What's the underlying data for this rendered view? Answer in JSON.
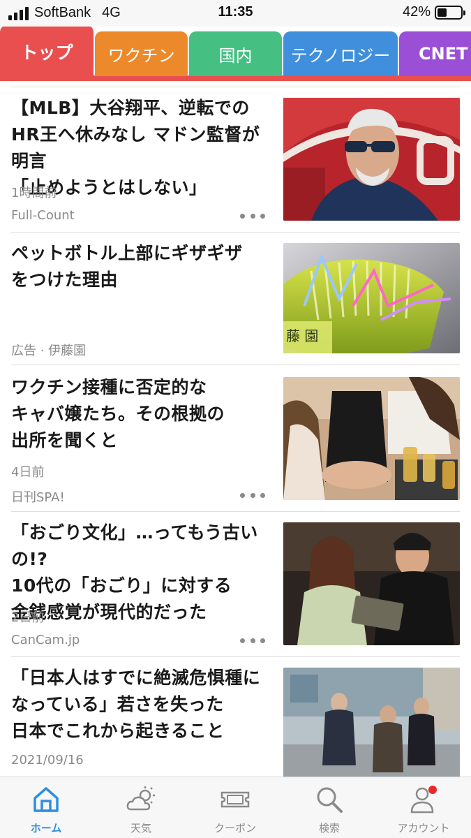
{
  "status_bar": {
    "carrier": "SoftBank",
    "network": "4G",
    "time": "11:35",
    "battery_percent": "42%",
    "battery_level": 0.42
  },
  "tabs": [
    {
      "label": "トップ",
      "color": "#e94f4f",
      "active": true
    },
    {
      "label": "ワクチン",
      "color": "#ec8a2b",
      "active": false
    },
    {
      "label": "国内",
      "color": "#45bf82",
      "active": false
    },
    {
      "label": "テクノロジー",
      "color": "#3f8fdd",
      "active": false
    },
    {
      "label": "CNET",
      "color": "#9b4fd6",
      "active": false
    }
  ],
  "articles": [
    {
      "title": "【MLB】大谷翔平、逆転での\nHR王へ休みなし マドン監督が明言\n「止めようとはしない」",
      "time": "1時間前",
      "source": "Full-Count",
      "image": "older-man-sunglasses-photo",
      "has_more": true
    },
    {
      "title": "ペットボトル上部にギザギザ\nをつけた理由",
      "time": "",
      "source": "広告 · 伊藤園",
      "image": "green-tea-bottle-ad-photo",
      "has_more": false
    },
    {
      "title": "ワクチン接種に否定的な\nキャバ嬢たち。その根拠の\n出所を聞くと",
      "time": "4日前",
      "source": "日刊SPA!",
      "image": "hostess-club-photo",
      "has_more": true
    },
    {
      "title": "「おごり文化」…ってもう古いの!?\n10代の「おごり」に対する\n金銭感覚が現代的だった",
      "time": "2日前",
      "source": "CanCam.jp",
      "image": "couple-paying-bill-photo",
      "has_more": true
    },
    {
      "title": "「日本人はすでに絶滅危惧種に\nなっている」若さを失った\n日本でこれから起きること",
      "time": "2021/09/16",
      "source": "",
      "image": "elderly-people-street-photo",
      "has_more": false
    }
  ],
  "bottom_nav": [
    {
      "label": "ホーム",
      "icon": "home-icon",
      "active": true
    },
    {
      "label": "天気",
      "icon": "weather-icon",
      "active": false
    },
    {
      "label": "クーポン",
      "icon": "coupon-icon",
      "active": false
    },
    {
      "label": "検索",
      "icon": "search-icon",
      "active": false
    },
    {
      "label": "アカウント",
      "icon": "account-icon",
      "active": false,
      "notification": true
    }
  ],
  "colors": {
    "accent": "#e94f4f",
    "nav_active": "#2f8fe0",
    "badge": "#e8282b"
  }
}
